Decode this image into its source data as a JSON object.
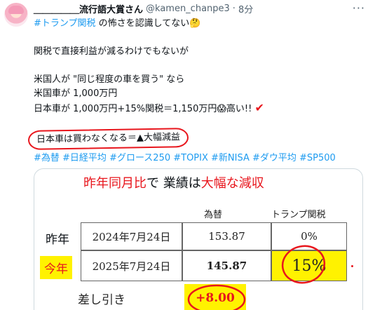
{
  "tweet": {
    "display_name": "＿＿＿＿＿流行語大賞さん",
    "handle": "@kamen_chanpe3",
    "separator": "·",
    "time": "8分",
    "more": "···",
    "lines": {
      "l1_tag": "#トランプ関税",
      "l1_rest": " の怖さを認識してない🤔",
      "l2": "関税で直接利益が減るわけでもないが",
      "l3": "米国人が \"同じ程度の車を買う\" なら",
      "l4": "米国車が 1,000万円",
      "l5": "日本車が 1,000万円+15%関税＝1,150万円😱高い!!",
      "check": "✔",
      "l6": "日本車は買わなくなる＝▲大幅減益"
    },
    "hashtags": "#為替 #日経平均 #グロース250 #TOPIX #新NISA #ダウ平均 #SP500"
  },
  "card": {
    "title_red1": "昨年同月比",
    "title_mid": "で 業績は",
    "title_red2": "大幅な減収",
    "col1": "為替",
    "col2": "トランプ関税",
    "rows": [
      {
        "label": "昨年",
        "date": "2024年7月24日",
        "fx": "153.87",
        "tariff": "0%"
      },
      {
        "label": "今年",
        "date": "2025年7月24日",
        "fx": "145.87",
        "tariff": "15%"
      }
    ],
    "diff_label": "差し引き",
    "diff_value": "+8.00"
  }
}
